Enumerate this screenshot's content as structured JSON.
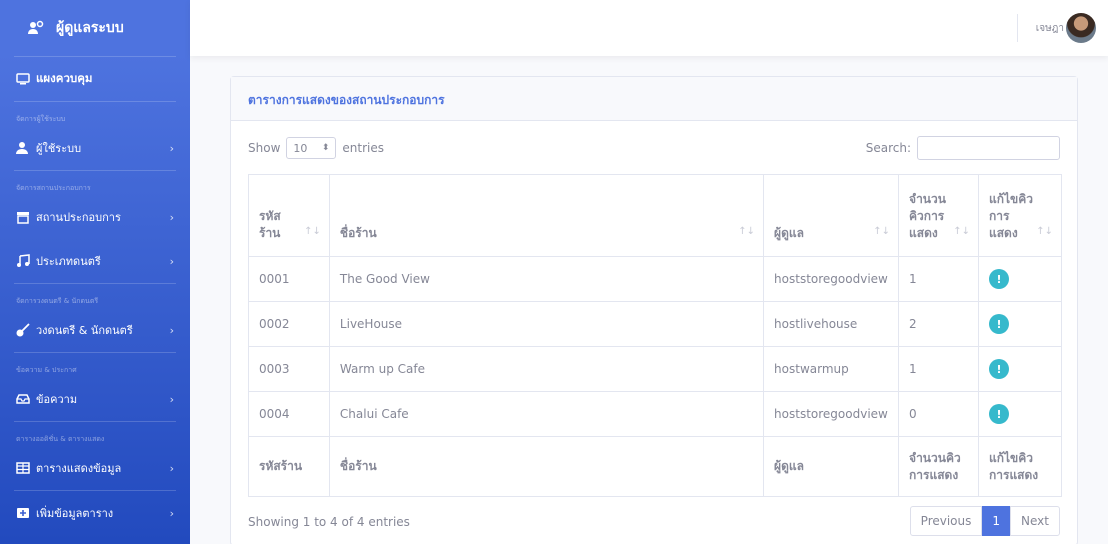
{
  "sidebar": {
    "brand": "ผู้ดูแลระบบ",
    "dashboard": "แผงควบคุม",
    "sections": [
      {
        "heading": "จัดการผู้ใช้ระบบ",
        "items": [
          {
            "label": "ผู้ใช้ระบบ",
            "icon": "user-icon"
          }
        ]
      },
      {
        "heading": "จัดการสถานประกอบการ",
        "items": [
          {
            "label": "สถานประกอบการ",
            "icon": "store-icon"
          },
          {
            "label": "ประเภทดนตรี",
            "icon": "music-icon"
          }
        ]
      },
      {
        "heading": "จัดการวงดนตรี & นักดนตรี",
        "items": [
          {
            "label": "วงดนตรี & นักดนตรี",
            "icon": "guitar-icon"
          }
        ]
      },
      {
        "heading": "ข้อความ & ประกาศ",
        "items": [
          {
            "label": "ข้อความ",
            "icon": "message-icon"
          }
        ]
      },
      {
        "heading": "ตารางออดิชั่น & ตารางแสดง",
        "items": [
          {
            "label": "ตารางแสดงข้อมูล",
            "icon": "table-icon"
          },
          {
            "label": "เพิ่มข้อมูลตาราง",
            "icon": "add-icon"
          }
        ]
      }
    ],
    "chevron": "›"
  },
  "topbar": {
    "username": "เจษฎา"
  },
  "card": {
    "title": "ตารางการแสดงของสถานประกอบการ",
    "show_label": "Show",
    "entries_value": "10",
    "entries_label": "entries",
    "search_label": "Search:",
    "columns": [
      "รหัสร้าน",
      "ชื่อร้าน",
      "ผู้ดูแล",
      "จำนวนคิวการแสดง",
      "แก้ไขคิวการแสดง"
    ],
    "rows": [
      {
        "id": "0001",
        "name": "The Good View",
        "admin": "hoststoregoodview",
        "count": "1"
      },
      {
        "id": "0002",
        "name": "LiveHouse",
        "admin": "hostlivehouse",
        "count": "2"
      },
      {
        "id": "0003",
        "name": "Warm up Cafe",
        "admin": "hostwarmup",
        "count": "1"
      },
      {
        "id": "0004",
        "name": "Chalui Cafe",
        "admin": "hoststoregoodview",
        "count": "0"
      }
    ],
    "info": "Showing 1 to 4 of 4 entries",
    "pager": {
      "previous": "Previous",
      "current": "1",
      "next": "Next"
    }
  },
  "colors": {
    "primary": "#4e73df",
    "info": "#36b9cc"
  }
}
